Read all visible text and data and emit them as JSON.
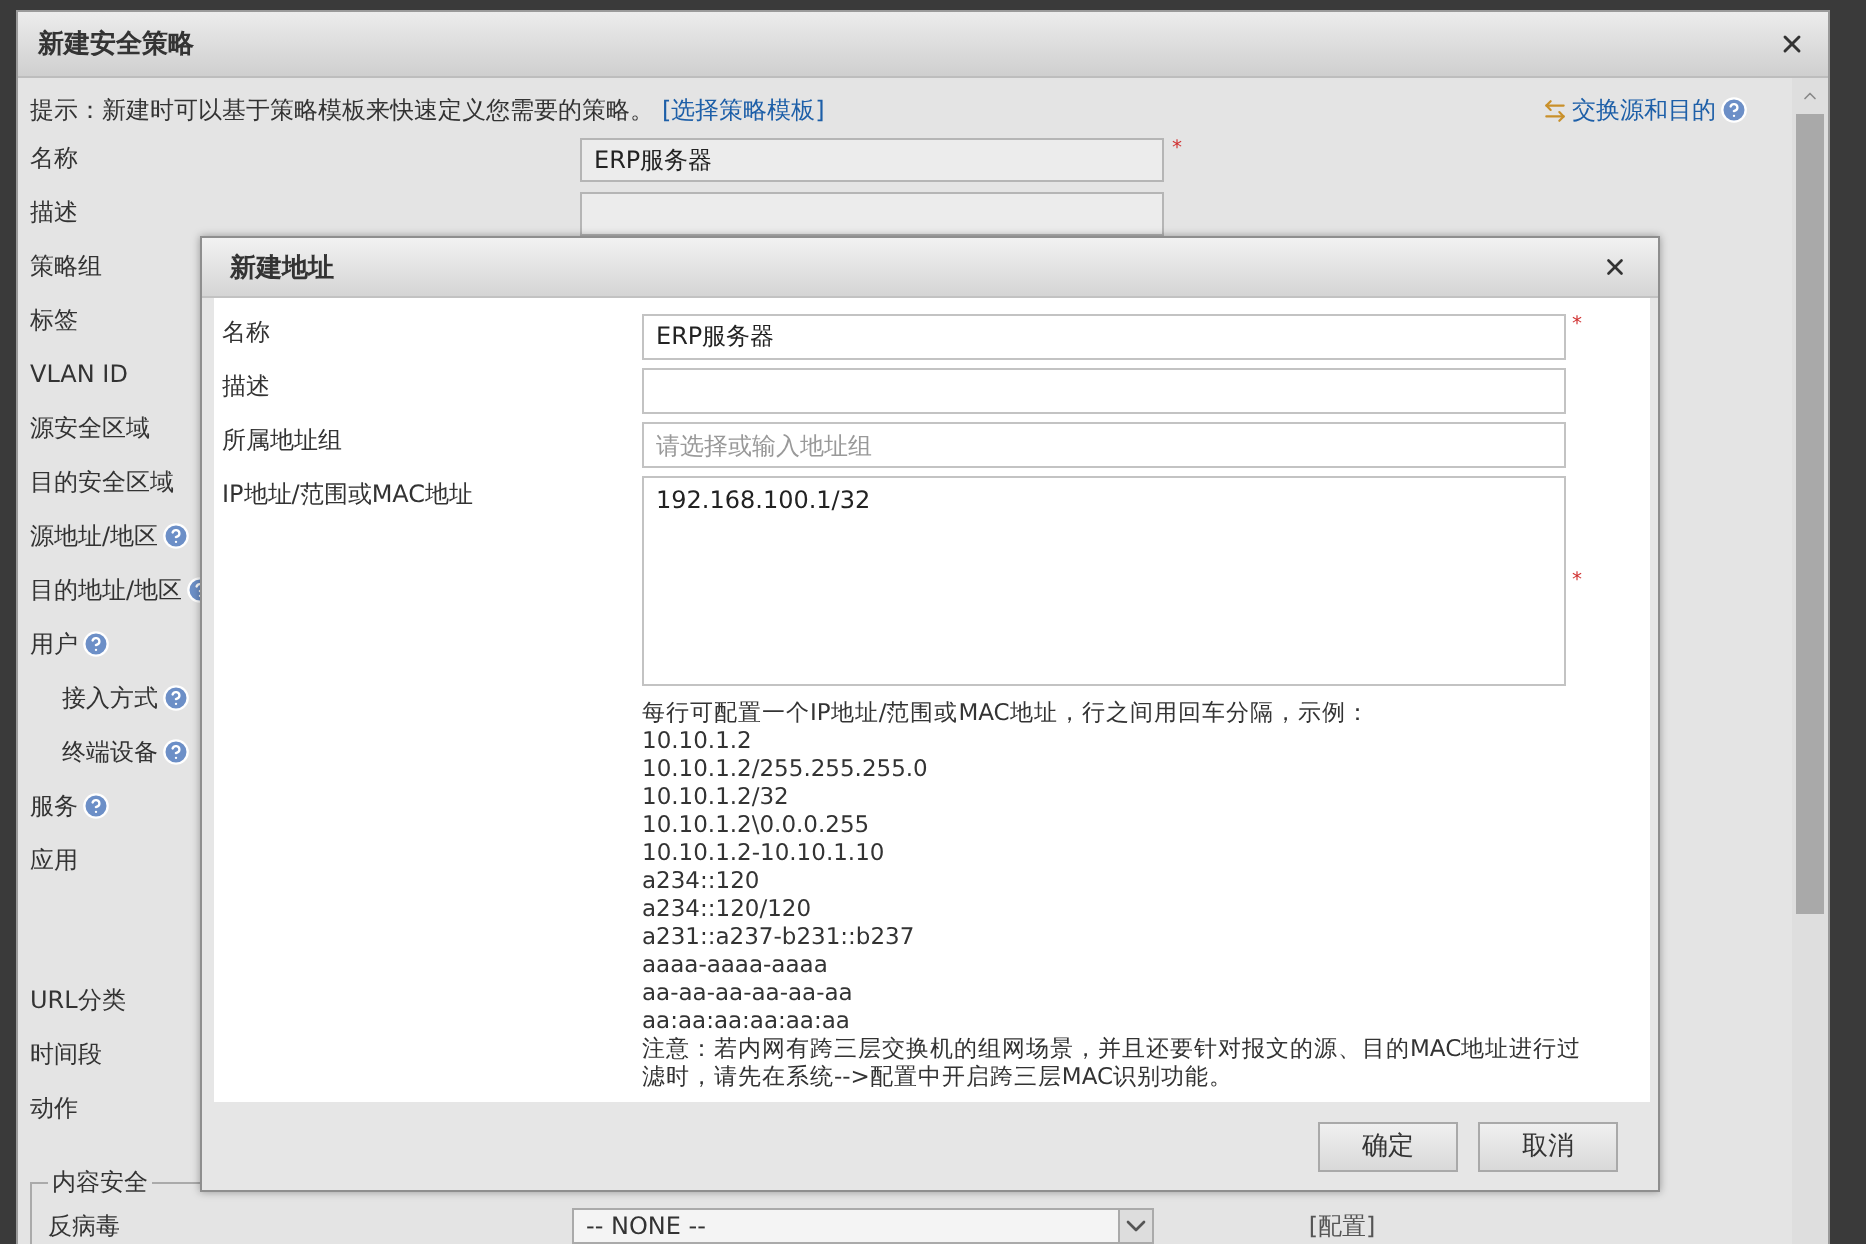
{
  "policy_dialog": {
    "title": "新建安全策略",
    "hint": "提示：新建时可以基于策略模板来快速定义您需要的策略。",
    "template_link": "[选择策略模板]",
    "swap_link": "交换源和目的",
    "fields": [
      {
        "label": "名称",
        "kind": "input",
        "value": "ERP服务器",
        "mark": "*"
      },
      {
        "label": "描述",
        "kind": "input"
      },
      {
        "label": "策略组",
        "kind": "plain"
      },
      {
        "label": "标签",
        "kind": "plain"
      },
      {
        "label": "VLAN ID",
        "kind": "plain"
      },
      {
        "label": "源安全区域",
        "kind": "plain"
      },
      {
        "label": "目的安全区域",
        "kind": "plain"
      },
      {
        "label": "源地址/地区",
        "kind": "plain",
        "help": true
      },
      {
        "label": "目的地址/地区",
        "kind": "plain",
        "help": true
      },
      {
        "label": "用户",
        "kind": "plain",
        "help": true,
        "children": [
          {
            "label": "接入方式",
            "kind": "plain",
            "help": true
          },
          {
            "label": "终端设备",
            "kind": "plain",
            "help": true
          }
        ]
      },
      {
        "label": "服务",
        "kind": "plain",
        "help": true
      },
      {
        "label": "应用",
        "kind": "tall"
      },
      {
        "label": "URL分类",
        "kind": "plain"
      },
      {
        "label": "时间段",
        "kind": "plain"
      },
      {
        "label": "动作",
        "kind": "plain"
      }
    ],
    "content_security": {
      "legend": "内容安全",
      "rows": [
        {
          "label": "反病毒",
          "value": "-- NONE --",
          "link": "[配置]"
        }
      ]
    }
  },
  "address_dialog": {
    "title": "新建地址",
    "fields": [
      {
        "label": "名称",
        "kind": "input",
        "value": "ERP服务器",
        "mark": "*"
      },
      {
        "label": "描述",
        "kind": "input"
      },
      {
        "label": "所属地址组",
        "kind": "input",
        "placeholder": "请选择或输入地址组"
      },
      {
        "label": "IP地址/范围或MAC地址",
        "kind": "textarea",
        "value": "192.168.100.1/32",
        "mark": "*"
      }
    ],
    "help_intro": "每行可配置一个IP地址/范围或MAC地址，行之间用回车分隔，示例：",
    "examples": [
      "10.10.1.2",
      "10.10.1.2/255.255.255.0",
      "10.10.1.2/32",
      "10.10.1.2\\0.0.0.255",
      "10.10.1.2-10.10.1.10",
      "a234::120",
      "a234::120/120",
      "a231::a237-b231::b237",
      "aaaa-aaaa-aaaa",
      "aa-aa-aa-aa-aa-aa",
      "aa:aa:aa:aa:aa:aa"
    ],
    "note": "注意：若内网有跨三层交换机的组网场景，并且还要针对报文的源、目的MAC地址进行过滤时，请先在系统-->配置中开启跨三层MAC识别功能。",
    "buttons": [
      "确定",
      "取消"
    ]
  }
}
